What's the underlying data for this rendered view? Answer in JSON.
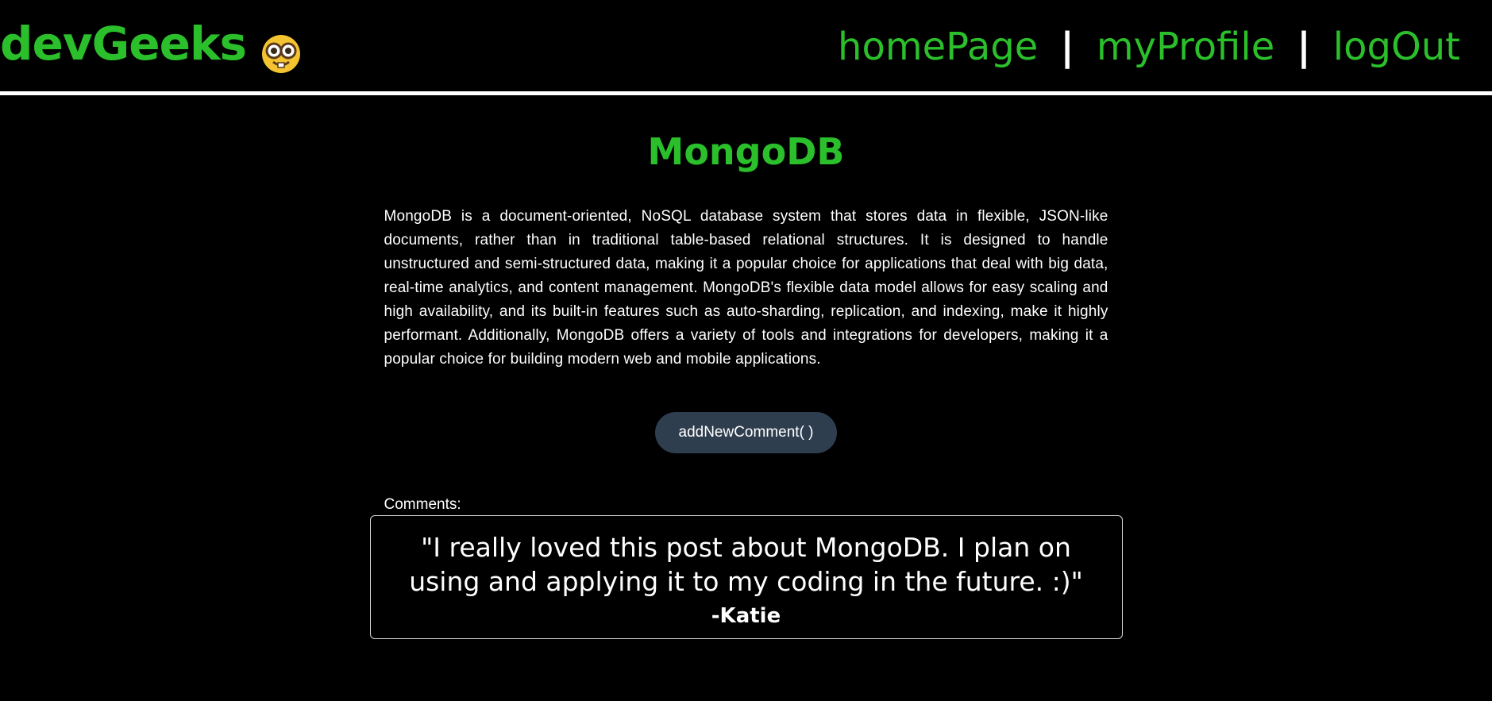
{
  "header": {
    "logo_text": "devGeeks",
    "logo_icon": "nerd-face-icon",
    "nav": {
      "home": "homePage",
      "profile": "myProfile",
      "logout": "logOut",
      "separator": "|"
    }
  },
  "post": {
    "title": "MongoDB",
    "description": "MongoDB is a document-oriented, NoSQL database system that stores data in flexible, JSON-like documents, rather than in traditional table-based relational structures. It is designed to handle unstructured and semi-structured data, making it a popular choice for applications that deal with big data, real-time analytics, and content management. MongoDB's flexible data model allows for easy scaling and high availability, and its built-in features such as auto-sharding, replication, and indexing, make it highly performant. Additionally, MongoDB offers a variety of tools and integrations for developers, making it a popular choice for building modern web and mobile applications.",
    "add_comment_label": "addNewComment( )"
  },
  "comments": {
    "label": "Comments:",
    "items": [
      {
        "text": "\"I really loved this post about MongoDB. I plan on using and applying it to my coding in the future. :)\"",
        "author": "-Katie"
      }
    ]
  },
  "colors": {
    "accent": "#2bbf2b",
    "background": "#000000",
    "button": "#2f3e4f",
    "text": "#ffffff"
  }
}
